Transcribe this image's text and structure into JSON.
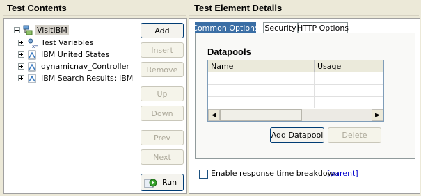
{
  "left": {
    "title": "Test Contents",
    "tree": [
      {
        "label": "VisitIBM",
        "icon": "test-suite-icon",
        "expander": "minus",
        "selected": true
      },
      {
        "label": "Test Variables",
        "icon": "variables-icon",
        "expander": "plus"
      },
      {
        "label": "IBM United States",
        "icon": "page-icon",
        "expander": "plus"
      },
      {
        "label": "dynamicnav_Controller",
        "icon": "page-icon",
        "expander": "plus"
      },
      {
        "label": "IBM Search Results: IBM",
        "icon": "page-icon",
        "expander": "plus"
      }
    ],
    "buttons": {
      "add": "Add",
      "insert": "Insert",
      "remove": "Remove",
      "up": "Up",
      "down": "Down",
      "prev": "Prev",
      "next": "Next",
      "run": "Run"
    }
  },
  "right": {
    "title": "Test Element Details",
    "tabs": [
      "Common Options",
      "Security",
      "HTTP Options"
    ],
    "active_tab": "Common Options",
    "datapools": {
      "title": "Datapools",
      "columns": [
        "Name",
        "Usage"
      ],
      "add_button": "Add Datapool",
      "delete_button": "Delete"
    },
    "checkbox_label": "Enable response time breakdown",
    "checkbox_checked": false,
    "parent_link": "[parent]"
  },
  "colors": {
    "background": "#ece9d8",
    "active_tab": "#3a6ea5",
    "link": "#0000cc",
    "disabled_text": "#aca899"
  }
}
